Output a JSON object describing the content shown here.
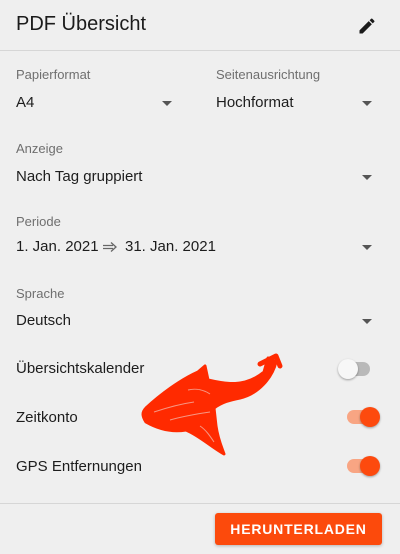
{
  "header": {
    "title": "PDF Übersicht",
    "edit_icon": "pencil-icon"
  },
  "fields": {
    "paper_format": {
      "label": "Papierformat",
      "value": "A4"
    },
    "orientation": {
      "label": "Seitenausrichtung",
      "value": "Hochformat"
    },
    "display": {
      "label": "Anzeige",
      "value": "Nach Tag gruppiert"
    },
    "period": {
      "label": "Periode",
      "start": "1. Jan. 2021",
      "end": "31. Jan. 2021",
      "arrow_icon": "double-arrow-right-icon"
    },
    "language": {
      "label": "Sprache",
      "value": "Deutsch"
    }
  },
  "toggles": {
    "overview_calendar": {
      "label": "Übersichtskalender",
      "on": false
    },
    "time_account": {
      "label": "Zeitkonto",
      "on": true
    },
    "gps_distances": {
      "label": "GPS Entfernungen",
      "on": true
    }
  },
  "footer": {
    "download_label": "HERUNTERLADEN"
  },
  "colors": {
    "accent": "#fc4a0c",
    "annotation": "#ff2a00",
    "background": "#efefef"
  }
}
